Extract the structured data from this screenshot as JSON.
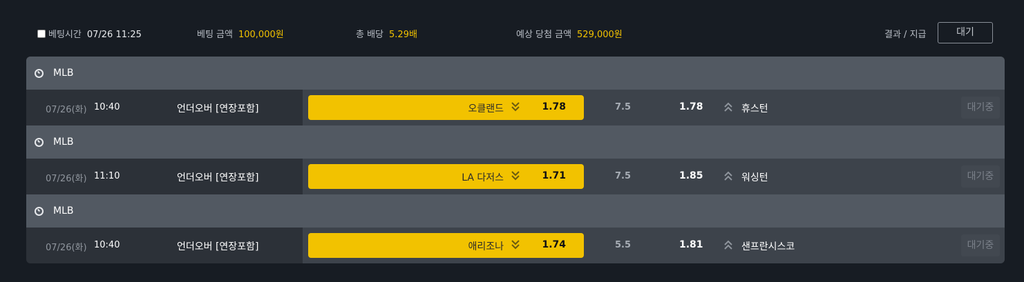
{
  "topbar": {
    "bet_time_label": "베팅시간",
    "bet_time_value": "07/26 11:25",
    "bet_amount_label": "베팅 금액",
    "bet_amount_value": "100,000원",
    "total_odds_label": "총 배당",
    "total_odds_value": "5.29배",
    "expected_win_label": "예상 당첨 금액",
    "expected_win_value": "529,000원",
    "result_label": "결과 / 지급",
    "result_button": "대기"
  },
  "colors": {
    "accent_yellow": "#f2c200",
    "background": "#171c23",
    "league_bar": "#525962"
  },
  "groups": [
    {
      "league": "MLB",
      "league_icon": "baseball-icon",
      "match": {
        "date": "07/26(화)",
        "time": "10:40",
        "market": "언더오버 [연장포함]",
        "home_team": "오클랜드",
        "home_arrow_icon": "double-chevron-down-icon",
        "home_odds": "1.78",
        "line": "7.5",
        "away_odds": "1.78",
        "away_arrow_icon": "double-chevron-up-icon",
        "away_team": "휴스턴",
        "status": "대기중"
      }
    },
    {
      "league": "MLB",
      "league_icon": "baseball-icon",
      "match": {
        "date": "07/26(화)",
        "time": "11:10",
        "market": "언더오버 [연장포함]",
        "home_team": "LA 다저스",
        "home_arrow_icon": "double-chevron-down-icon",
        "home_odds": "1.71",
        "line": "7.5",
        "away_odds": "1.85",
        "away_arrow_icon": "double-chevron-up-icon",
        "away_team": "워싱턴",
        "status": "대기중"
      }
    },
    {
      "league": "MLB",
      "league_icon": "baseball-icon",
      "match": {
        "date": "07/26(화)",
        "time": "10:40",
        "market": "언더오버 [연장포함]",
        "home_team": "애리조나",
        "home_arrow_icon": "double-chevron-down-icon",
        "home_odds": "1.74",
        "line": "5.5",
        "away_odds": "1.81",
        "away_arrow_icon": "double-chevron-up-icon",
        "away_team": "샌프란시스코",
        "status": "대기중"
      }
    }
  ]
}
